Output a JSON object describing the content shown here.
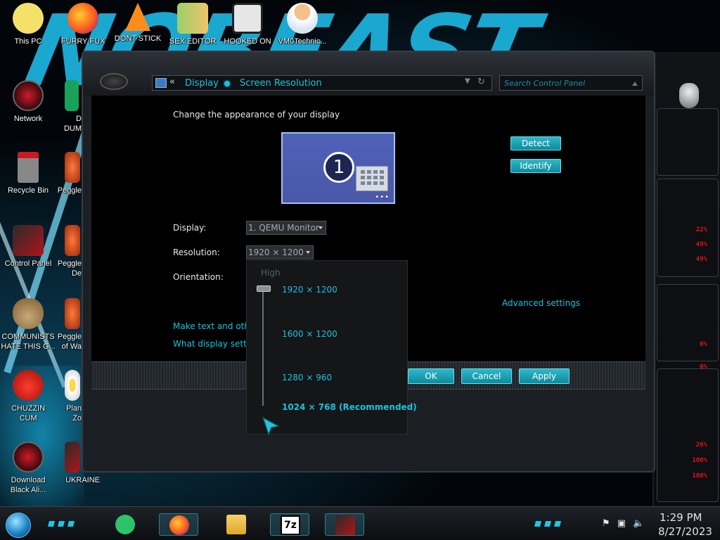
{
  "desktop": {
    "icons_top": [
      {
        "label": "This PC"
      },
      {
        "label": "FURRY FUX"
      },
      {
        "label": "DONT STICK"
      },
      {
        "label": "SEX EDITOR"
      },
      {
        "label": "HOOKED ON"
      },
      {
        "label": "VM0Technic..."
      }
    ],
    "icons_left": [
      {
        "label": "Network"
      },
      {
        "label": "Recycle Bin"
      },
      {
        "label": "Control Panel"
      },
      {
        "label1": "COMMUNISTS",
        "label2": "HATE THIS G..."
      },
      {
        "label1": "CHUZZIN",
        "label2": "CUM"
      },
      {
        "label1": "Download",
        "label2": "Black Ali..."
      }
    ],
    "icons_second": [
      {
        "label1": "D",
        "label2": "DUM"
      },
      {
        "label1": "Peggle",
        "label2": ""
      },
      {
        "label1": "Peggle",
        "label2": "De"
      },
      {
        "label1": "Peggle",
        "label2": "of Wa"
      },
      {
        "label1": "Plan",
        "label2": "Zo"
      },
      {
        "label1": "UKRAINE",
        "label2": ""
      }
    ]
  },
  "window": {
    "breadcrumb": {
      "back": "«",
      "crumb1": "Display",
      "crumb2": "Screen Resolution"
    },
    "search_placeholder": "Search Control Panel",
    "heading": "Change the appearance of your display",
    "monitor_number": "1",
    "monitor_dots": "•••",
    "detect_button": "Detect",
    "identify_button": "Identify",
    "display_label": "Display:",
    "display_value": "1. QEMU Monitor",
    "resolution_label": "Resolution:",
    "resolution_value": "1920 × 1200",
    "orientation_label": "Orientation:",
    "advanced_link": "Advanced settings",
    "link1": "Make text and other",
    "link2": "What display setting",
    "ok_button": "OK",
    "cancel_button": "Cancel",
    "apply_button": "Apply"
  },
  "resolution_slider": {
    "high_label": "High",
    "options": [
      {
        "label": "1920 × 1200",
        "bold": false
      },
      {
        "label": "1600 × 1200",
        "bold": false
      },
      {
        "label": "1280 × 960",
        "bold": false
      },
      {
        "label": "1024 × 768 (Recommended)",
        "bold": true
      }
    ],
    "selected": "1920 × 1200"
  },
  "right_panel": {
    "readouts": [
      "22%",
      "49%",
      "49%",
      "0%",
      "0%",
      "26%",
      "100%",
      "100%"
    ]
  },
  "taskbar": {
    "apps": [
      "notes-app",
      "firefox",
      "file-explorer",
      "7zip",
      "alienware-app"
    ],
    "clock_time": "1:29 PM",
    "clock_date": "8/27/2023"
  },
  "colors": {
    "accent_cyan": "#18c3e0",
    "alien_red": "#e0141b",
    "window_bg": "#1b1f24"
  }
}
